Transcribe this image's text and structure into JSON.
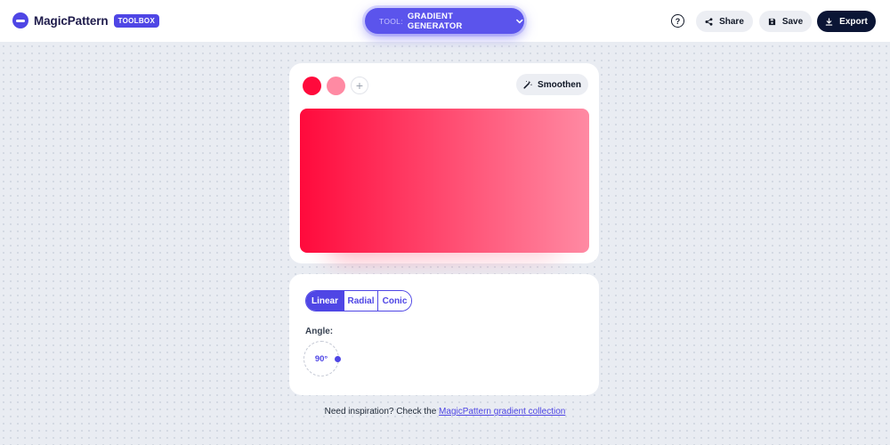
{
  "header": {
    "brand": "MagicPattern",
    "badge": "TOOLBOX",
    "tool_prefix": "TOOL:",
    "tool_name": "GRADIENT GENERATOR",
    "help_label": "?",
    "share_label": "Share",
    "save_label": "Save",
    "export_label": "Export",
    "icons": {
      "logo": "magicpattern-logo-icon",
      "chevron": "chevron-down-icon",
      "help": "help-circle-icon",
      "share": "share-icon",
      "save": "save-icon",
      "export": "download-icon"
    }
  },
  "editor": {
    "colors": [
      "#ff0a3c",
      "#ff8aa3"
    ],
    "add_color_label": "+",
    "smoothen_label": "Smoothen",
    "smoothen_icon": "magic-wand-icon"
  },
  "settings": {
    "types": [
      "Linear",
      "Radial",
      "Conic"
    ],
    "selected_type": "Linear",
    "angle_label": "Angle:",
    "angle_value": "90°",
    "angle_degrees": 90
  },
  "footer": {
    "text": "Need inspiration? Check the",
    "link": "MagicPattern gradient collection"
  },
  "theme": {
    "accent": "#4f46e5",
    "dark": "#0b1535",
    "background": "#e9ecf2"
  }
}
